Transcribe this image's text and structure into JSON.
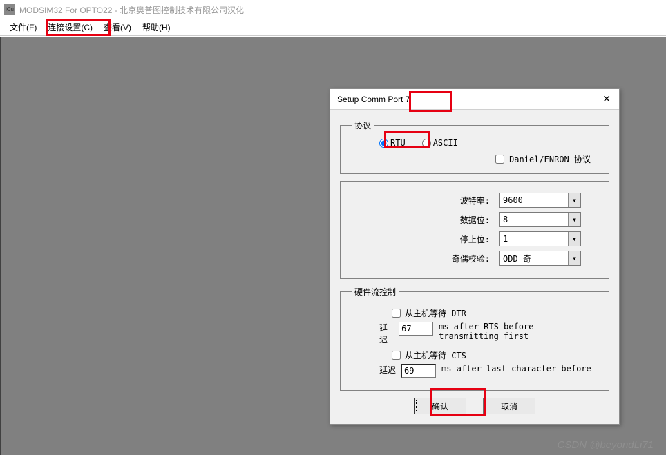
{
  "window": {
    "title": "MODSIM32 For OPTO22 - 北京奥普图控制技术有限公司汉化"
  },
  "menu": {
    "file": "文件(F)",
    "connection": "连接设置(C)",
    "view": "查看(V)",
    "help": "帮助(H)"
  },
  "dialog": {
    "title": "Setup Comm Port 7",
    "protocol": {
      "legend": "协议",
      "rtu": "RTU",
      "ascii": "ASCII",
      "daniel_label": "Daniel/ENRON 协议"
    },
    "params": {
      "baud_label": "波特率:",
      "baud_value": "9600",
      "databits_label": "数据位:",
      "databits_value": "8",
      "stopbits_label": "停止位:",
      "stopbits_value": "1",
      "parity_label": "奇偶校验:",
      "parity_value": "ODD 奇"
    },
    "flow": {
      "legend": "硬件流控制",
      "dtr_label": "从主机等待 DTR",
      "cts_label": "从主机等待 CTS",
      "delay_label": "延迟",
      "dtr_delay": "67",
      "dtr_hint": "ms after RTS before transmitting first",
      "cts_delay": "69",
      "cts_hint": "ms after last character before"
    },
    "buttons": {
      "ok": "确认",
      "cancel": "取消"
    }
  },
  "watermark": "CSDN @beyondLi71"
}
